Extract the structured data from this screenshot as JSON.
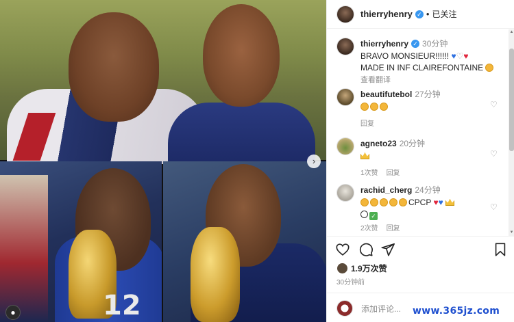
{
  "header": {
    "username": "thierryhenry",
    "separator": "•",
    "follow_state": "已关注"
  },
  "caption": {
    "username": "thierryhenry",
    "time": "30分钟",
    "text_line1": "BRAVO MONSIEUR!!!!!!",
    "text_line2": "MADE IN INF CLAIREFONTAINE",
    "translate": "查看翻译"
  },
  "comments": [
    {
      "username": "beautifutebol",
      "time": "27分钟",
      "reply": "回复"
    },
    {
      "username": "agneto23",
      "time": "20分钟",
      "likes": "1次赞",
      "reply": "回复"
    },
    {
      "username": "rachid_cherg",
      "time": "24分钟",
      "text_cpcp": "CPCP",
      "likes": "2次赞",
      "reply": "回复"
    }
  ],
  "actions": {
    "like_icon": "heart-icon",
    "comment_icon": "comment-icon",
    "share_icon": "send-icon",
    "save_icon": "bookmark-icon",
    "likes_count": "1.9万次赞",
    "posted_time": "30分钟前",
    "comment_placeholder": "添加评论..."
  },
  "photo": {
    "jersey_number": "12"
  },
  "watermark": "www.365jz.com",
  "colors": {
    "verified": "#3897f0",
    "secondary_text": "#8e8e8e",
    "watermark": "#1e4fcf"
  }
}
